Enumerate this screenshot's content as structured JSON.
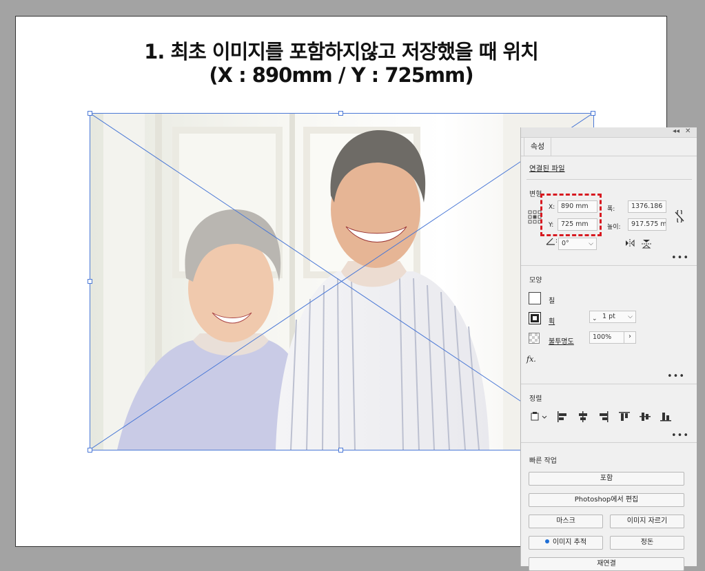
{
  "caption": {
    "line1": "1. 최초 이미지를 포함하지않고 저장했을 때 위치",
    "line2": "(X : 890mm / Y : 725mm)"
  },
  "panel": {
    "tab": "속성",
    "linked_file": "연결된 파일",
    "transform": {
      "title": "변형",
      "x_label": "X:",
      "x_value": "890 mm",
      "y_label": "Y:",
      "y_value": "725 mm",
      "width_label": "폭:",
      "width_value": "1376.186",
      "height_label": "높이:",
      "height_value": "917.575 m",
      "angle_label": ":",
      "angle_value": "0°"
    },
    "appearance": {
      "title": "모양",
      "fill_label": "칠",
      "stroke_label": "획",
      "stroke_value": "1 pt",
      "opacity_label": "불투명도",
      "opacity_value": "100%",
      "fx_label": "fx."
    },
    "align": {
      "title": "정렬"
    },
    "quick_actions": {
      "title": "빠른 작업",
      "embed": "포함",
      "edit_in_photoshop": "Photoshop에서 편집",
      "mask": "마스크",
      "crop_image": "이미지 자르기",
      "image_trace": "이미지 추적",
      "arrange": "정돈",
      "relink": "재연결"
    },
    "more": "•••"
  },
  "colors": {
    "highlight": "#d71920",
    "selection": "#4a78d6",
    "trace_dot": "#1f6fd6"
  }
}
